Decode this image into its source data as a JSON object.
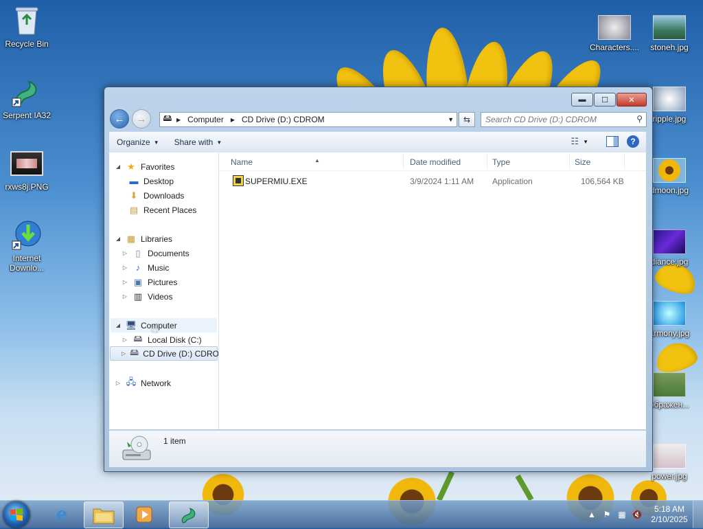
{
  "desktop": {
    "icons_left": [
      {
        "label": "Recycle Bin",
        "icon": "recycle-bin-icon"
      },
      {
        "label": "Serpent IA32",
        "icon": "serpent-dragon-icon"
      },
      {
        "label": "rxws8j.PNG",
        "icon": "image-thumbnail-icon"
      },
      {
        "label": "Internet Downlo...",
        "icon": "download-manager-icon"
      }
    ],
    "icons_right": [
      {
        "label": "Characters....",
        "icon": "image-thumbnail-icon"
      },
      {
        "label": "stoneh.jpg",
        "icon": "image-thumbnail-icon"
      },
      {
        "label": "ripple.jpg",
        "icon": "image-thumbnail-icon"
      },
      {
        "label": "dmoon.jpg",
        "icon": "image-thumbnail-icon"
      },
      {
        "label": "diance.jpg",
        "icon": "image-thumbnail-icon"
      },
      {
        "label": "armony.jpg",
        "icon": "image-thumbnail-icon"
      },
      {
        "label": "ображен...",
        "icon": "image-thumbnail-icon"
      },
      {
        "label": "power.jpg",
        "icon": "image-thumbnail-icon"
      }
    ]
  },
  "window": {
    "caption_buttons": {
      "minimize": "▬",
      "maximize": "☐",
      "close": "✕"
    },
    "address": {
      "segments": [
        "Computer",
        "CD Drive (D:) CDROM"
      ]
    },
    "search": {
      "placeholder": "Search CD Drive (D:) CDROM"
    },
    "toolbar": {
      "organize": "Organize",
      "share_with": "Share with"
    },
    "nav": {
      "favorites": {
        "label": "Favorites",
        "items": [
          "Desktop",
          "Downloads",
          "Recent Places"
        ]
      },
      "libraries": {
        "label": "Libraries",
        "items": [
          "Documents",
          "Music",
          "Pictures",
          "Videos"
        ]
      },
      "computer": {
        "label": "Computer",
        "items": [
          "Local Disk (C:)",
          "CD Drive (D:) CDROM"
        ]
      },
      "network": {
        "label": "Network"
      }
    },
    "columns": {
      "name": "Name",
      "date": "Date modified",
      "type": "Type",
      "size": "Size"
    },
    "files": [
      {
        "name": "SUPERMIU.EXE",
        "date": "3/9/2024 1:11 AM",
        "type": "Application",
        "size": "106,564 KB"
      }
    ],
    "status": {
      "item_count": "1 item"
    }
  },
  "taskbar": {
    "clock_time": "5:18 AM",
    "clock_date": "2/10/2025"
  },
  "colors": {
    "accent": "#2b64b0",
    "selection": "#dce8f6",
    "taskbar": "#3c6496"
  }
}
